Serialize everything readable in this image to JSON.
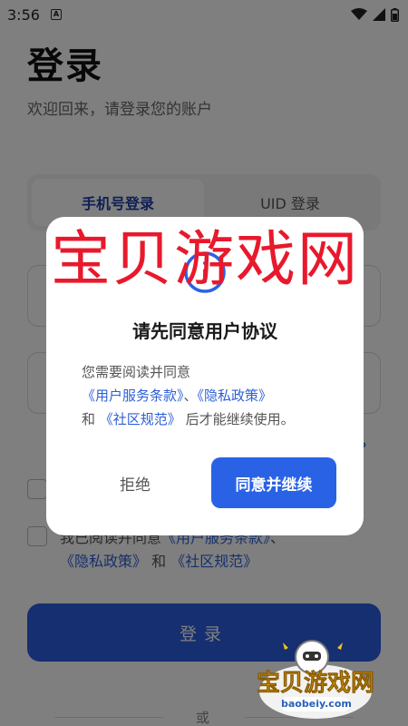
{
  "status_bar": {
    "time": "3:56",
    "notification": "A"
  },
  "page": {
    "title": "登录",
    "subtitle": "欢迎回来，请登录您的账户",
    "tabs": [
      {
        "label": "手机号登录",
        "active": true
      },
      {
        "label": "UID 登录",
        "active": false
      }
    ],
    "forgot_label": "?",
    "agreement": {
      "prefix": "我已阅读并同意",
      "terms": "《用户服务条款》",
      "sep": "、",
      "privacy": "《隐私政策》",
      "and": "和",
      "community": "《社区规范》"
    },
    "login_button": "登录",
    "or_label": "或"
  },
  "dialog": {
    "title": "请先同意用户协议",
    "message_prefix": "您需要阅读并同意",
    "terms": "《用户服务条款》",
    "sep": "、",
    "privacy": "《隐私政策》",
    "and": "和",
    "community": "《社区规范》",
    "message_suffix": "后才能继续使用。",
    "reject_label": "拒绝",
    "accept_label": "同意并继续"
  },
  "watermark": {
    "text": "宝贝游戏网",
    "logo_name": "宝贝游戏网",
    "logo_url": "baobeiy.com"
  },
  "colors": {
    "accent": "#2a62e6",
    "link": "#2c5fd8",
    "watermark_red": "#e8192c",
    "overlay": "rgba(0,0,0,0.5)"
  },
  "icons": {
    "dialog_icon": "info-circle-icon",
    "wifi": "wifi-icon",
    "signal": "signal-icon",
    "battery": "battery-icon"
  }
}
